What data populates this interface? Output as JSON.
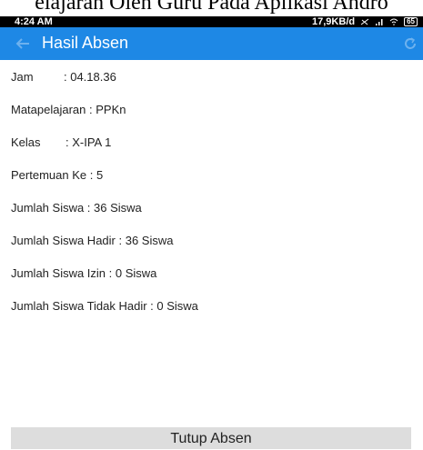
{
  "caption": "elajaran Oleh Guru Pada Aplikasi Andro",
  "status_bar": {
    "time": "4:24 AM",
    "network_speed": "17,9KB/d",
    "battery": "65"
  },
  "app_bar": {
    "title": "Hasil Absen",
    "back_icon": "arrow-left-icon",
    "refresh_icon": "refresh-icon",
    "color": "#1e88e5"
  },
  "fields": {
    "jam_label": "Jam",
    "jam_value": ": 04.18.36",
    "matapelajaran": "Matapelajaran : PPKn",
    "kelas_label": "Kelas",
    "kelas_value": ": X-IPA 1",
    "pertemuan": "Pertemuan Ke : 5",
    "jumlah_siswa": "Jumlah Siswa : 36 Siswa",
    "jumlah_hadir": "Jumlah Siswa Hadir : 36 Siswa",
    "jumlah_izin": "Jumlah Siswa Izin : 0 Siswa",
    "jumlah_tidak_hadir": "Jumlah Siswa Tidak Hadir : 0 Siswa"
  },
  "close_button": {
    "label": "Tutup Absen"
  }
}
